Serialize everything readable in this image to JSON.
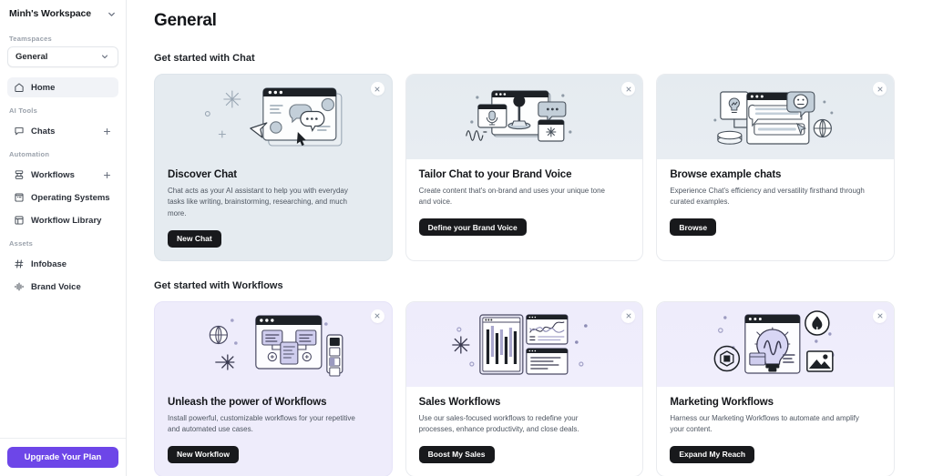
{
  "sidebar": {
    "workspace_name": "Minh's Workspace",
    "workspace_chevron_icon": "chevron-down-icon",
    "teamspaces_label": "Teamspaces",
    "teamspace_selected": "General",
    "teamspace_chevron_icon": "chevron-down-icon",
    "home": {
      "label": "Home",
      "icon": "home-icon"
    },
    "ai_tools_label": "AI Tools",
    "ai_tools": [
      {
        "label": "Chats",
        "icon": "chat-bubble-icon",
        "action_icon": "plus-icon"
      }
    ],
    "automation_label": "Automation",
    "automation": [
      {
        "label": "Workflows",
        "icon": "workflow-icon",
        "action_icon": "plus-icon"
      },
      {
        "label": "Operating Systems",
        "icon": "operating-system-icon",
        "action_icon": ""
      },
      {
        "label": "Workflow Library",
        "icon": "library-icon",
        "action_icon": ""
      }
    ],
    "assets_label": "Assets",
    "assets": [
      {
        "label": "Infobase",
        "icon": "hash-icon",
        "action_icon": ""
      },
      {
        "label": "Brand Voice",
        "icon": "waveform-icon",
        "action_icon": ""
      }
    ],
    "upgrade_label": "Upgrade Your Plan",
    "upgrade_color": "#6d46e8"
  },
  "main": {
    "page_title": "General",
    "sections": [
      {
        "heading": "Get started with Chat",
        "theme": "chat",
        "cards": [
          {
            "title": "Discover Chat",
            "desc": "Chat acts as your AI assistant to help you with everyday tasks like writing, brainstorming, researching, and much more.",
            "button": "New Chat",
            "close_icon": "close-icon",
            "illustration": "chat-window-speech-bubbles",
            "full_tint": true
          },
          {
            "title": "Tailor Chat to your Brand Voice",
            "desc": "Create content that's on-brand and uses your unique tone and voice.",
            "button": "Define your Brand Voice",
            "close_icon": "close-icon",
            "illustration": "microphone-brand-voice",
            "full_tint": false
          },
          {
            "title": "Browse example chats",
            "desc": "Experience Chat's efficiency and versatility firsthand through curated examples.",
            "button": "Browse",
            "close_icon": "close-icon",
            "illustration": "example-chats-globe",
            "full_tint": false
          }
        ]
      },
      {
        "heading": "Get started with Workflows",
        "theme": "wf",
        "cards": [
          {
            "title": "Unleash the power of Workflows",
            "desc": "Install powerful, customizable workflows for your repetitive and automated use cases.",
            "button": "New Workflow",
            "close_icon": "close-icon",
            "illustration": "workflow-diagram-globe",
            "full_tint": true
          },
          {
            "title": "Sales Workflows",
            "desc": "Use our sales-focused workflows to redefine your processes, enhance productivity, and close deals.",
            "button": "Boost My Sales",
            "close_icon": "close-icon",
            "illustration": "sales-charts",
            "full_tint": false
          },
          {
            "title": "Marketing Workflows",
            "desc": "Harness our Marketing Workflows to automate and amplify your content.",
            "button": "Expand My Reach",
            "close_icon": "close-icon",
            "illustration": "marketing-lightbulb",
            "full_tint": false
          }
        ]
      }
    ]
  },
  "colors": {
    "chat_tint": "#e5ebf0",
    "workflow_tint": "#eeecfb",
    "button_dark": "#18191c",
    "accent_purple": "#6d46e8"
  }
}
